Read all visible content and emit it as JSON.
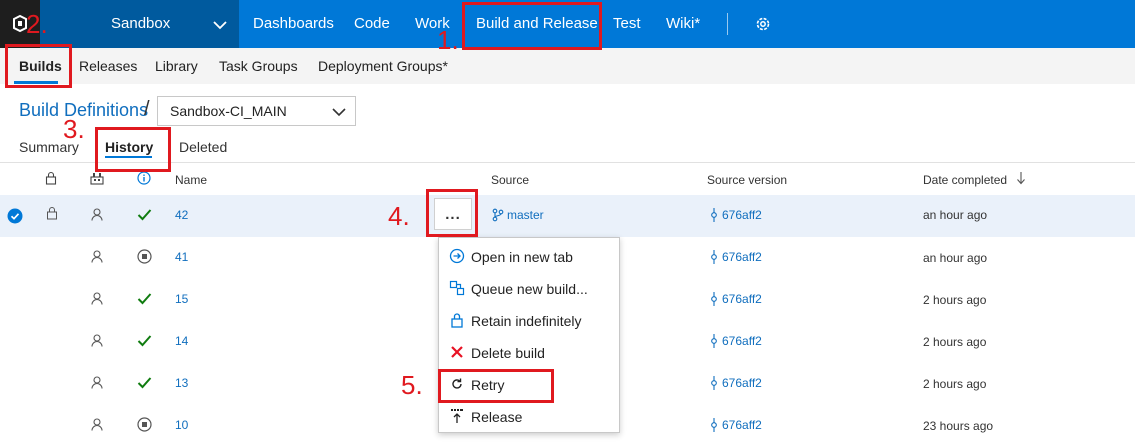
{
  "topnav": {
    "project": "Sandbox",
    "items": [
      "Dashboards",
      "Code",
      "Work",
      "Build and Release",
      "Test",
      "Wiki*"
    ]
  },
  "subnav": {
    "items": [
      "Builds",
      "Releases",
      "Library",
      "Task Groups",
      "Deployment Groups*"
    ]
  },
  "breadcrumb": {
    "link": "Build Definitions",
    "separator": "/",
    "definition": "Sandbox-CI_MAIN"
  },
  "pivots": [
    "Summary",
    "History",
    "Deleted"
  ],
  "table": {
    "headers": {
      "name": "Name",
      "source": "Source",
      "source_version": "Source version",
      "date_completed": "Date completed"
    },
    "rows": [
      {
        "name": "42",
        "status": "success",
        "source": "master",
        "version": "676aff2",
        "date": "an hour ago"
      },
      {
        "name": "41",
        "status": "stopped",
        "version": "676aff2",
        "date": "an hour ago"
      },
      {
        "name": "15",
        "status": "success",
        "version": "676aff2",
        "date": "2 hours ago"
      },
      {
        "name": "14",
        "status": "success",
        "version": "676aff2",
        "date": "2 hours ago"
      },
      {
        "name": "13",
        "status": "success",
        "version": "676aff2",
        "date": "2 hours ago"
      },
      {
        "name": "10",
        "status": "stopped",
        "version": "676aff2",
        "date": "23 hours ago"
      }
    ]
  },
  "more_button": "...",
  "context_menu": {
    "items": [
      "Open in new tab",
      "Queue new build...",
      "Retain indefinitely",
      "Delete build",
      "Retry",
      "Release"
    ]
  },
  "annotations": [
    "1.",
    "2.",
    "3.",
    "4.",
    "5."
  ],
  "colors": {
    "nav_blue": "#0078d7",
    "project_blue": "#005a9e",
    "link_blue": "#106ebe",
    "success_green": "#107c10",
    "delete_red": "#e81123",
    "annotation_red": "#e0191f"
  }
}
